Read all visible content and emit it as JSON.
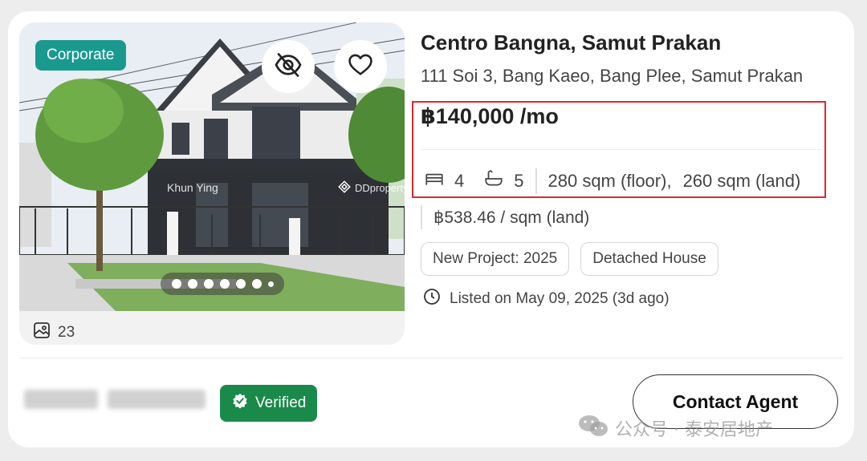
{
  "listing": {
    "badge": "Corporate",
    "photo_watermark_name": "Khun Ying",
    "photo_watermark_brand": "DDproperty",
    "photo_count": "23",
    "title": "Centro Bangna, Samut Prakan",
    "address": "111 Soi 3, Bang Kaeo, Bang Plee, Samut Prakan",
    "price": "฿140,000 /mo",
    "beds": "4",
    "baths": "5",
    "floor_area": "280 sqm (floor),",
    "land_area": "260 sqm (land)",
    "price_per_sqm": "฿538.46 / sqm (land)",
    "tags": [
      "New Project: 2025",
      "Detached House"
    ],
    "listed": "Listed on May 09, 2025 (3d ago)"
  },
  "carousel": {
    "total_dots": 7,
    "active_index": 0
  },
  "agent": {
    "verified_label": "Verified",
    "contact_label": "Contact Agent"
  },
  "overlay": {
    "wechat_watermark": "公众号 · 泰安居地产"
  },
  "colors": {
    "corporate_badge": "#1a9a8e",
    "verified_badge": "#1a8a4a",
    "highlight_border": "#e0262b"
  },
  "icons": [
    "eye-slash-icon",
    "heart-icon",
    "gallery-icon",
    "bed-icon",
    "bath-icon",
    "clock-icon",
    "check-badge-icon",
    "wechat-icon",
    "ddproperty-logo-icon"
  ]
}
